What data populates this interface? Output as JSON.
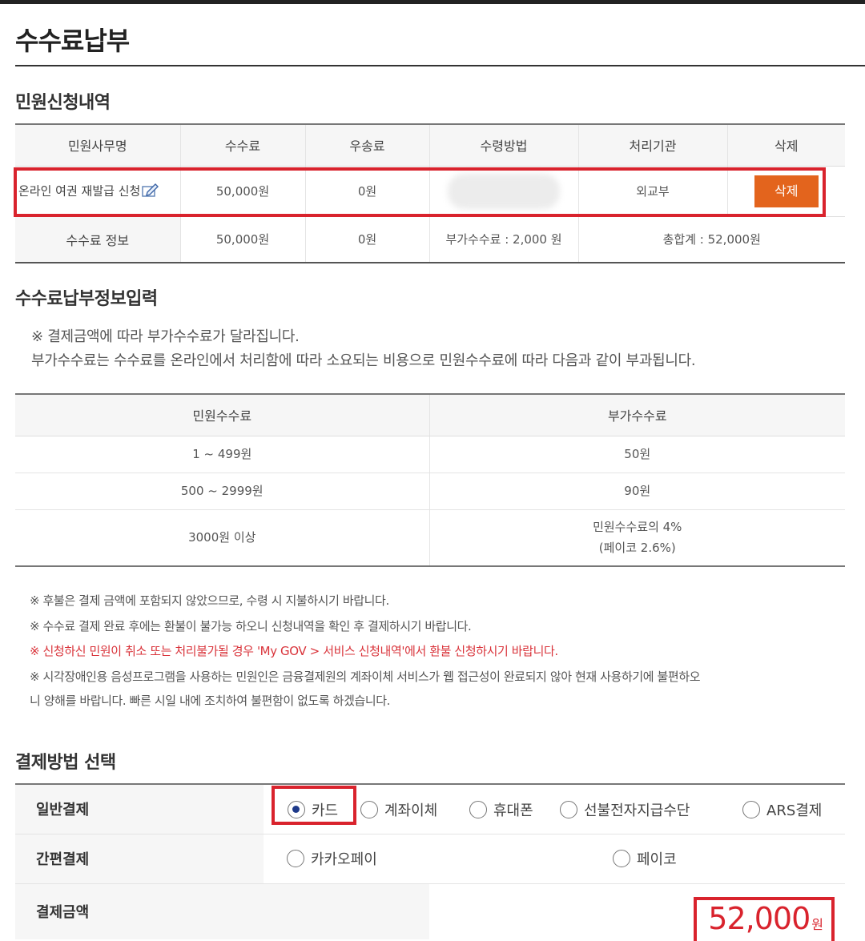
{
  "page": {
    "title": "수수료납부"
  },
  "application": {
    "section_title": "민원신청내역",
    "headers": [
      "민원사무명",
      "수수료",
      "우송료",
      "수령방법",
      "처리기관",
      "삭제"
    ],
    "row": {
      "name": "온라인 여권 재발급 신청",
      "fee": "50,000원",
      "postage": "0원",
      "receipt_method": "",
      "agency": "외교부",
      "delete_label": "삭제"
    },
    "fee_info": {
      "label": "수수료 정보",
      "fee": "50,000원",
      "postage": "0원",
      "surcharge": "부가수수료 : 2,000 원",
      "total": "총합계 : 52,000원"
    }
  },
  "payment_info": {
    "section_title": "수수료납부정보입력",
    "notice_lines": [
      "※ 결제금액에 따라 부가수수료가 달라집니다.",
      "부가수수료는 수수료를 온라인에서 처리함에 따라 소요되는 비용으로 민원수수료에 따라 다음과 같이 부과됩니다."
    ],
    "surcharge_table": {
      "headers": [
        "민원수수료",
        "부가수수료"
      ],
      "rows": [
        {
          "fee": "1 ~ 499원",
          "surcharge": "50원",
          "surcharge2": ""
        },
        {
          "fee": "500 ~ 2999원",
          "surcharge": "90원",
          "surcharge2": ""
        },
        {
          "fee": "3000원 이상",
          "surcharge": "민원수수료의 4%",
          "surcharge2": "(페이코 2.6%)"
        }
      ]
    },
    "notes": [
      "※ 후불은 결제 금액에 포함되지 않았으므로, 수령 시 지불하시기 바랍니다.",
      "※ 수수료 결제 완료 후에는 환불이 불가능 하오니 신청내역을 확인 후 결제하시기 바랍니다.",
      "※ 신청하신 민원이 취소 또는 처리불가될 경우 'My GOV > 서비스 신청내역'에서 환불 신청하시기 바랍니다.",
      "※ 시각장애인용 음성프로그램을 사용하는 민원인은 금융결제원의 계좌이체 서비스가 웹 접근성이 완료되지 않아 현재 사용하기에 불편하오",
      "니 양해를 바랍니다. 빠른 시일 내에 조치하여 불편함이 없도록 하겠습니다."
    ]
  },
  "payment_method": {
    "section_title": "결제방법 선택",
    "general": {
      "label": "일반결제",
      "options": [
        "카드",
        "계좌이체",
        "휴대폰",
        "선불전자지급수단",
        "ARS결제"
      ],
      "selected": "카드"
    },
    "simple": {
      "label": "간편결제",
      "options": [
        "카카오페이",
        "페이코"
      ]
    },
    "amount": {
      "label": "결제금액",
      "value": "52,000",
      "unit": "원"
    }
  },
  "colors": {
    "accent_orange": "#e3641d",
    "highlight_red": "#d9232d",
    "note_red": "#d9333a",
    "radio_selected": "#1e3a8a"
  }
}
